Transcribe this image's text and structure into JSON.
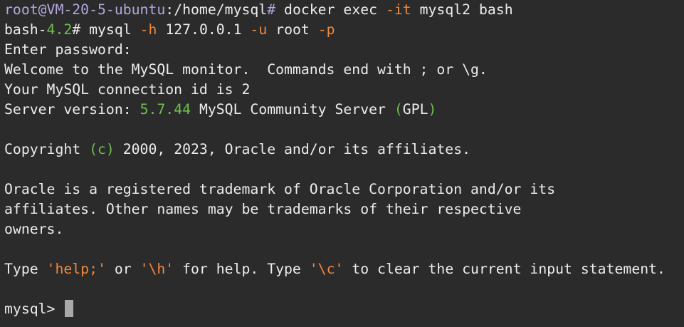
{
  "terminal": {
    "line1": {
      "prompt": "root@VM-20-5-ubuntu",
      "path_sep": ":",
      "path": "/home/mysql",
      "hash": "#",
      "cmd_a": " docker exec ",
      "flag": "-it",
      "cmd_b": " mysql2 bash"
    },
    "line2": {
      "shell_name": "bash-",
      "shell_version": "4.2",
      "hash": "#",
      "cmd_a": " mysql ",
      "flag_h": "-h",
      "host": " 127.0.0.1 ",
      "flag_u": "-u",
      "user": " root ",
      "flag_p": "-p"
    },
    "line3": "Enter password:",
    "line4": "Welcome to the MySQL monitor.  Commands end with ; or \\g.",
    "line5": "Your MySQL connection id is 2",
    "line6": {
      "label": "Server version: ",
      "version": "5.7.44",
      "rest": " MySQL Community Server ",
      "paren_open": "(",
      "license": "GPL",
      "paren_close": ")"
    },
    "line7": {
      "a": "Copyright ",
      "c": "(c)",
      "b": " 2000, 2023, Oracle and/or its affiliates."
    },
    "line8": "Oracle is a registered trademark of Oracle Corporation and/or its",
    "line9": "affiliates. Other names may be trademarks of their respective",
    "line10": "owners.",
    "line11": {
      "a": "Type ",
      "help": "'help;'",
      "b": " or ",
      "h": "'\\h'",
      "c": " for help. Type ",
      "clear": "'\\c'",
      "d": " to clear the current input statement."
    },
    "prompt": "mysql> "
  },
  "colors": {
    "background": "#2b2b2b",
    "foreground": "#ececec",
    "prompt": "#b4a7de",
    "green": "#6cc04a",
    "orange": "#f0883e",
    "cursor": "#a9a9a9"
  }
}
